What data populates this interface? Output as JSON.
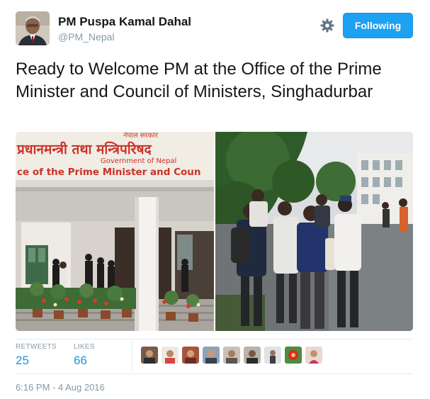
{
  "author": {
    "name": "PM Puspa Kamal Dahal",
    "handle": "@PM_Nepal"
  },
  "actions": {
    "settings_icon": "gear-icon",
    "follow_label": "Following",
    "follow_color": "#1da1f2"
  },
  "tweet": {
    "text": "Ready to Welcome PM at the Office of the Prime Minister and Council of Ministers, Singhadurbar"
  },
  "media": {
    "sign_line_1": "प्रधानमन्त्री तथा मन्त्रिपरिषद",
    "sign_line_2": "Government of Nepal",
    "sign_line_3": "ce of the Prime Minister and Coun",
    "sign_top": "नेपाल सरकार"
  },
  "stats": {
    "retweets_label": "RETWEETS",
    "retweets_value": "25",
    "likes_label": "LIKES",
    "likes_value": "66"
  },
  "timestamp": "6:16 PM - 4 Aug 2016",
  "colors": {
    "accent": "#1da1f2",
    "link": "#1b95e0",
    "muted": "#8899a6",
    "divider": "#e6ecf0"
  }
}
